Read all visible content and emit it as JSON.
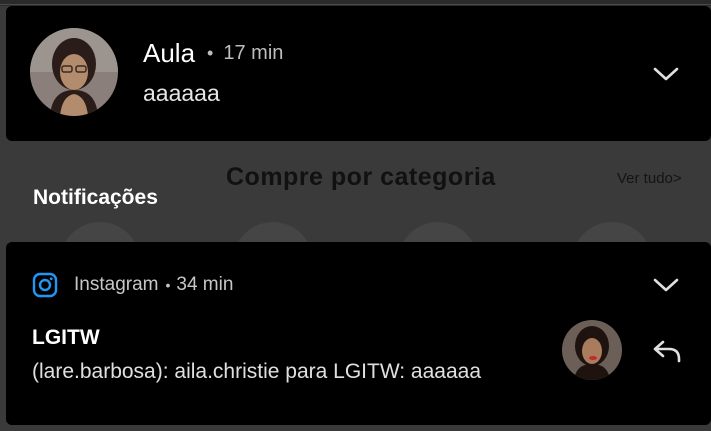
{
  "notification1": {
    "sender": "Aula",
    "separator": "•",
    "time": "17 min",
    "message": "aaaaaa",
    "avatar_icon": "contact-photo",
    "expand_icon": "chevron-down-icon"
  },
  "background_page": {
    "category_title": "Compre por categoria",
    "see_all": "Ver tudo>",
    "notifications_heading": "Notificações"
  },
  "notification2": {
    "app_name": "Instagram",
    "separator": "•",
    "time": "34 min",
    "group_title": "LGITW",
    "message": "(lare.barbosa): aila.christie para LGITW: aaaaaa",
    "app_icon": "instagram-icon",
    "avatar_icon": "contact-photo",
    "expand_icon": "chevron-down-icon",
    "reply_icon": "reply-icon"
  },
  "colors": {
    "card_background": "#000000",
    "shade_background": "#3a3a3a",
    "instagram_blue": "#2196f3"
  }
}
